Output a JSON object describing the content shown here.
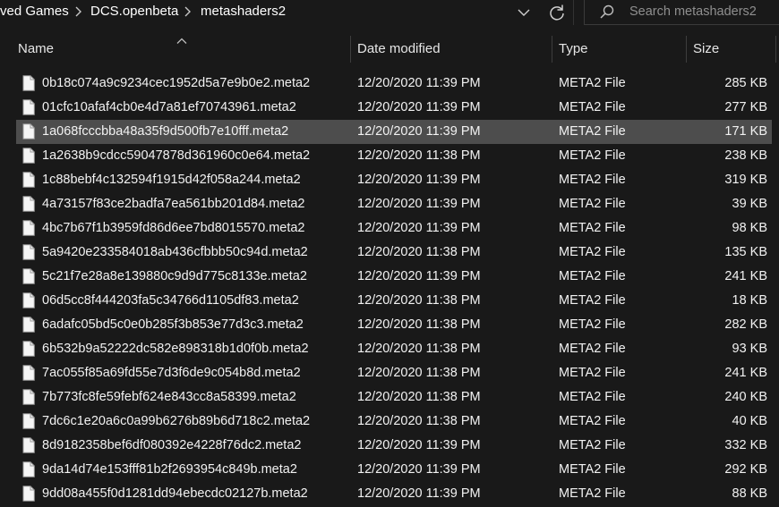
{
  "breadcrumb": [
    "ved Games",
    "DCS.openbeta",
    "metashaders2"
  ],
  "search": {
    "placeholder": "Search metashaders2"
  },
  "columns": {
    "name": "Name",
    "date": "Date modified",
    "type": "Type",
    "size": "Size"
  },
  "files": [
    {
      "name": "0b18c074a9c9234cec1952d5a7e9b0e2.meta2",
      "date": "12/20/2020 11:39 PM",
      "type": "META2 File",
      "size": "285 KB"
    },
    {
      "name": "01cfc10afaf4cb0e4d7a81ef70743961.meta2",
      "date": "12/20/2020 11:39 PM",
      "type": "META2 File",
      "size": "277 KB"
    },
    {
      "name": "1a068fcccbba48a35f9d500fb7e10fff.meta2",
      "date": "12/20/2020 11:39 PM",
      "type": "META2 File",
      "size": "171 KB",
      "selected": true
    },
    {
      "name": "1a2638b9cdcc59047878d361960c0e64.meta2",
      "date": "12/20/2020 11:38 PM",
      "type": "META2 File",
      "size": "238 KB"
    },
    {
      "name": "1c88bebf4c132594f1915d42f058a244.meta2",
      "date": "12/20/2020 11:39 PM",
      "type": "META2 File",
      "size": "319 KB"
    },
    {
      "name": "4a73157f83ce2badfa7ea561bb201d84.meta2",
      "date": "12/20/2020 11:39 PM",
      "type": "META2 File",
      "size": "39 KB"
    },
    {
      "name": "4bc7b67f1b3959fd86d6ee7bd8015570.meta2",
      "date": "12/20/2020 11:39 PM",
      "type": "META2 File",
      "size": "98 KB"
    },
    {
      "name": "5a9420e233584018ab436cfbbb50c94d.meta2",
      "date": "12/20/2020 11:38 PM",
      "type": "META2 File",
      "size": "135 KB"
    },
    {
      "name": "5c21f7e28a8e139880c9d9d775c8133e.meta2",
      "date": "12/20/2020 11:39 PM",
      "type": "META2 File",
      "size": "241 KB"
    },
    {
      "name": "06d5cc8f444203fa5c34766d1105df83.meta2",
      "date": "12/20/2020 11:38 PM",
      "type": "META2 File",
      "size": "18 KB"
    },
    {
      "name": "6adafc05bd5c0e0b285f3b853e77d3c3.meta2",
      "date": "12/20/2020 11:38 PM",
      "type": "META2 File",
      "size": "282 KB"
    },
    {
      "name": "6b532b9a52222dc582e898318b1d0f0b.meta2",
      "date": "12/20/2020 11:38 PM",
      "type": "META2 File",
      "size": "93 KB"
    },
    {
      "name": "7ac055f85a69fd55e7d3f6de9c054b8d.meta2",
      "date": "12/20/2020 11:38 PM",
      "type": "META2 File",
      "size": "241 KB"
    },
    {
      "name": "7b773fc8fe59febf624e843cc8a58399.meta2",
      "date": "12/20/2020 11:38 PM",
      "type": "META2 File",
      "size": "240 KB"
    },
    {
      "name": "7dc6c1e20a6c0a99b6276b89b6d718c2.meta2",
      "date": "12/20/2020 11:38 PM",
      "type": "META2 File",
      "size": "40 KB"
    },
    {
      "name": "8d9182358bef6df080392e4228f76dc2.meta2",
      "date": "12/20/2020 11:39 PM",
      "type": "META2 File",
      "size": "332 KB"
    },
    {
      "name": "9da14d74e153fff81b2f2693954c849b.meta2",
      "date": "12/20/2020 11:39 PM",
      "type": "META2 File",
      "size": "292 KB"
    },
    {
      "name": "9dd08a455f0d1281dd94ebecdc02127b.meta2",
      "date": "12/20/2020 11:39 PM",
      "type": "META2 File",
      "size": "88 KB"
    }
  ],
  "colors": {
    "background": "#191919",
    "selected_row": "#4d4d4d",
    "text": "#f2f2f2"
  }
}
